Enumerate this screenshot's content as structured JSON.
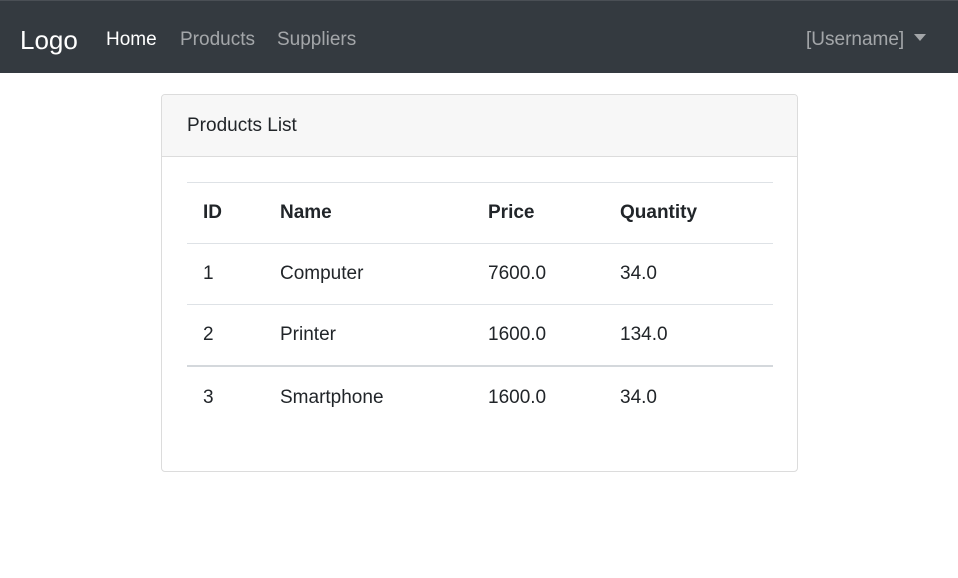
{
  "navbar": {
    "brand": "Logo",
    "links": [
      {
        "label": "Home",
        "active": true
      },
      {
        "label": "Products",
        "active": false
      },
      {
        "label": "Suppliers",
        "active": false
      }
    ],
    "user_menu": "[Username]",
    "background": "#343a40"
  },
  "card": {
    "title": "Products List"
  },
  "table": {
    "columns": [
      "ID",
      "Name",
      "Price",
      "Quantity"
    ],
    "rows": [
      [
        "1",
        "Computer",
        "7600.0",
        "34.0"
      ],
      [
        "2",
        "Printer",
        "1600.0",
        "134.0"
      ],
      [
        "3",
        "Smartphone",
        "1600.0",
        "34.0"
      ]
    ]
  }
}
